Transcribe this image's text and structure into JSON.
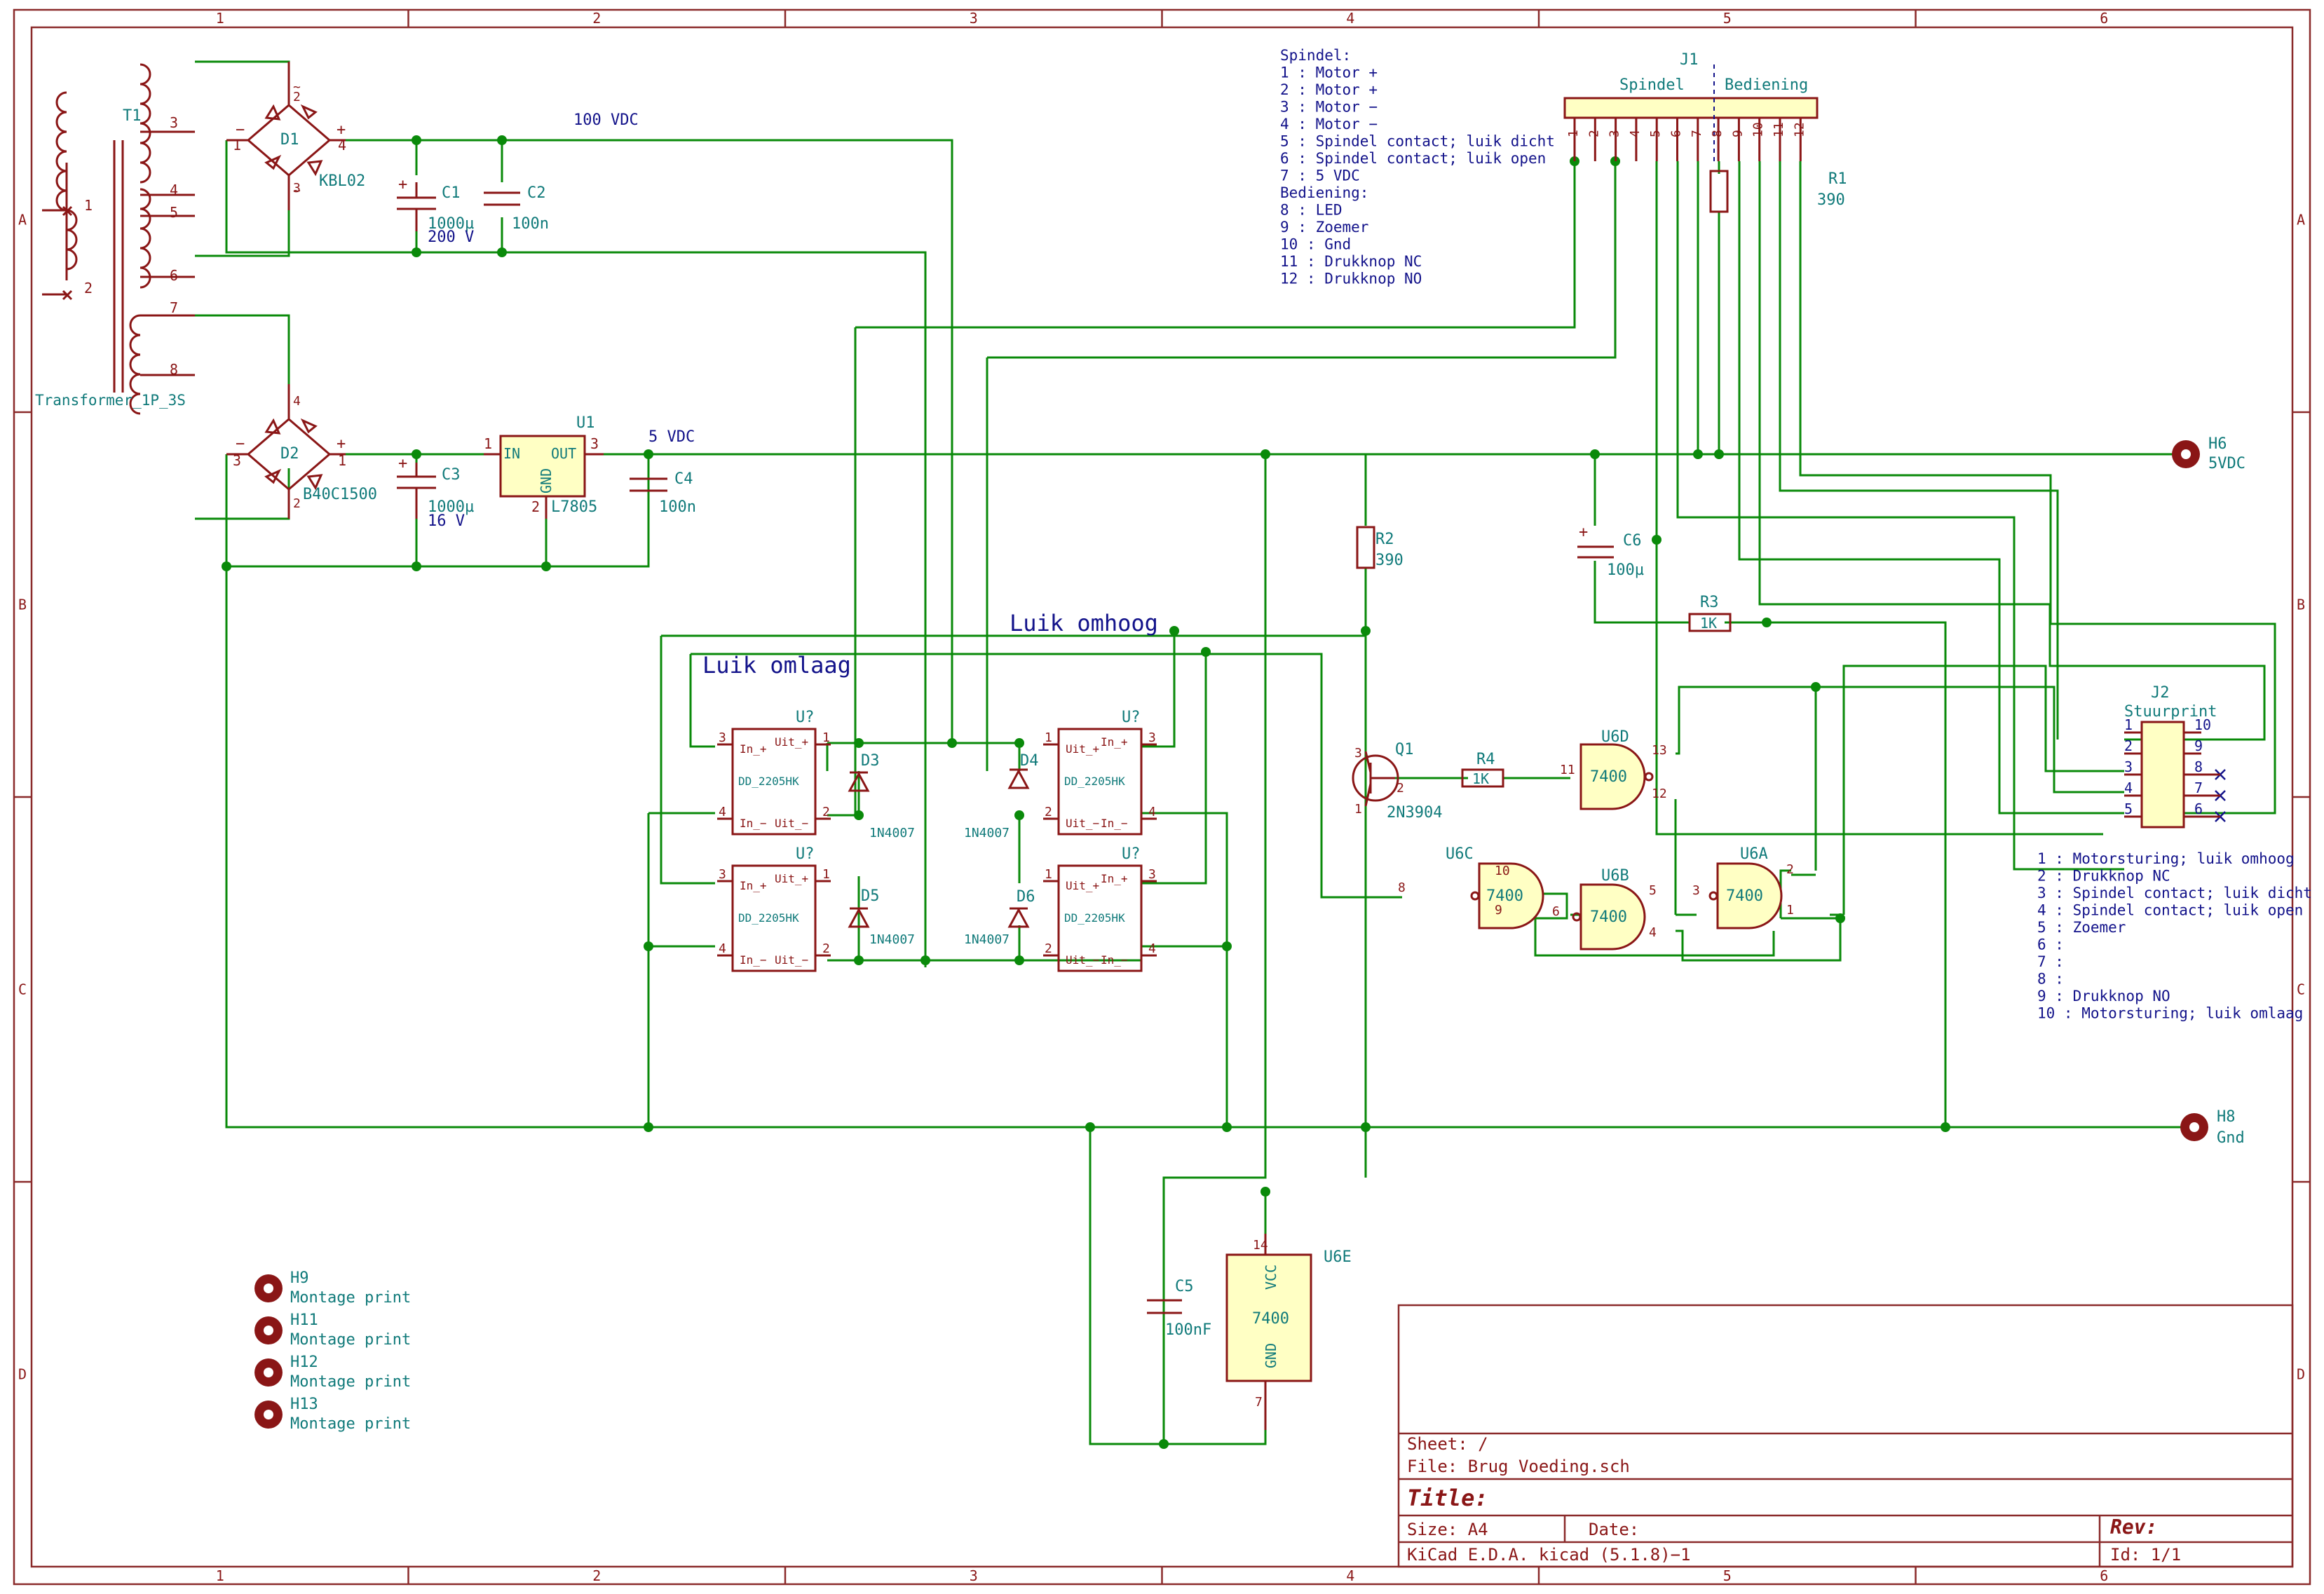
{
  "frame": {
    "columns": [
      "1",
      "2",
      "3",
      "4",
      "5",
      "6"
    ],
    "rows": [
      "A",
      "B",
      "C",
      "D"
    ]
  },
  "components": {
    "T1": {
      "ref": "T1",
      "value": "Transformer_1P_3S",
      "pins": [
        "1",
        "2",
        "3",
        "4",
        "5",
        "6",
        "7",
        "8"
      ]
    },
    "D1": {
      "ref": "D1",
      "value": "KBL02"
    },
    "D2": {
      "ref": "D2",
      "value": "B40C1500"
    },
    "C1": {
      "ref": "C1",
      "value": "1000µ",
      "rating": "200 V"
    },
    "C2": {
      "ref": "C2",
      "value": "100n"
    },
    "C3": {
      "ref": "C3",
      "value": "1000µ",
      "rating": "16 V"
    },
    "C4": {
      "ref": "C4",
      "value": "100n"
    },
    "C5": {
      "ref": "C5",
      "value": "100nF"
    },
    "C6": {
      "ref": "C6",
      "value": "100µ"
    },
    "U1": {
      "ref": "U1",
      "value": "L7805",
      "pin_in": "IN",
      "pin_out": "OUT",
      "pin_gnd": "GND"
    },
    "R1": {
      "ref": "R1",
      "value": "390"
    },
    "R2": {
      "ref": "R2",
      "value": "390"
    },
    "R3": {
      "ref": "R3",
      "value": "1K"
    },
    "R4": {
      "ref": "R4",
      "value": "1K"
    },
    "Q1": {
      "ref": "Q1",
      "value": "2N3904"
    },
    "D3": {
      "ref": "D3",
      "value": "1N4007"
    },
    "D4": {
      "ref": "D4",
      "value": "1N4007"
    },
    "D5": {
      "ref": "D5",
      "value": "1N4007"
    },
    "D6": {
      "ref": "D6",
      "value": "1N4007"
    },
    "relay": {
      "ref": "U?",
      "value": "DD_2205HK",
      "in_plus": "In_+",
      "in_minus": "In_−",
      "out_plus": "Uit_+",
      "out_minus": "Uit_−"
    },
    "U6A": {
      "ref": "U6A",
      "value": "7400"
    },
    "U6B": {
      "ref": "U6B",
      "value": "7400"
    },
    "U6C": {
      "ref": "U6C",
      "value": "7400"
    },
    "U6D": {
      "ref": "U6D",
      "value": "7400"
    },
    "U6E": {
      "ref": "U6E",
      "value": "7400",
      "vcc": "VCC",
      "gnd": "GND"
    },
    "J1": {
      "ref": "J1",
      "group_left": "Spindel",
      "group_right": "Bediening",
      "pins": [
        "1",
        "2",
        "3",
        "4",
        "5",
        "6",
        "7",
        "8",
        "9",
        "10",
        "11",
        "12"
      ]
    },
    "J2": {
      "ref": "J2",
      "value": "Stuurprint",
      "pins_left": [
        "1",
        "2",
        "3",
        "4",
        "5"
      ],
      "pins_right": [
        "10",
        "9",
        "8",
        "7",
        "6"
      ]
    },
    "H6": {
      "ref": "H6",
      "value": "5VDC"
    },
    "H8": {
      "ref": "H8",
      "value": "Gnd"
    },
    "H9": {
      "ref": "H9",
      "value": "Montage print"
    },
    "H11": {
      "ref": "H11",
      "value": "Montage print"
    },
    "H12": {
      "ref": "H12",
      "value": "Montage print"
    },
    "H13": {
      "ref": "H13",
      "value": "Montage print"
    }
  },
  "net_labels": {
    "v100": "100 VDC",
    "v5": "5 VDC",
    "up": "Luik omhoog",
    "down": "Luik omlaag"
  },
  "notes": {
    "j1": [
      "Spindel:",
      " 1 : Motor +",
      " 2 : Motor +",
      " 3 : Motor −",
      " 4 : Motor −",
      " 5 : Spindel contact; luik dicht",
      " 6 : Spindel contact; luik open",
      " 7 : 5 VDC",
      "Bediening:",
      " 8 : LED",
      " 9 : Zoemer",
      "10 : Gnd",
      "11 : Drukknop NC",
      "12 : Drukknop NO"
    ],
    "j2": [
      " 1 : Motorsturing; luik omhoog",
      " 2 : Drukknop NC",
      " 3 : Spindel contact; luik dicht",
      " 4 : Spindel contact; luik open",
      " 5 : Zoemer",
      " 6 :",
      " 7 :",
      " 8 :",
      " 9 : Drukknop NO",
      "10 : Motorsturing; luik omlaag"
    ]
  },
  "title_block": {
    "sheet": "Sheet: /",
    "file": "File: Brug Voeding.sch",
    "title": "Title:",
    "size": "Size: A4",
    "date": "Date:",
    "rev": "Rev:",
    "tool": "KiCad E.D.A.  kicad (5.1.8)−1",
    "id": "Id: 1/1"
  }
}
